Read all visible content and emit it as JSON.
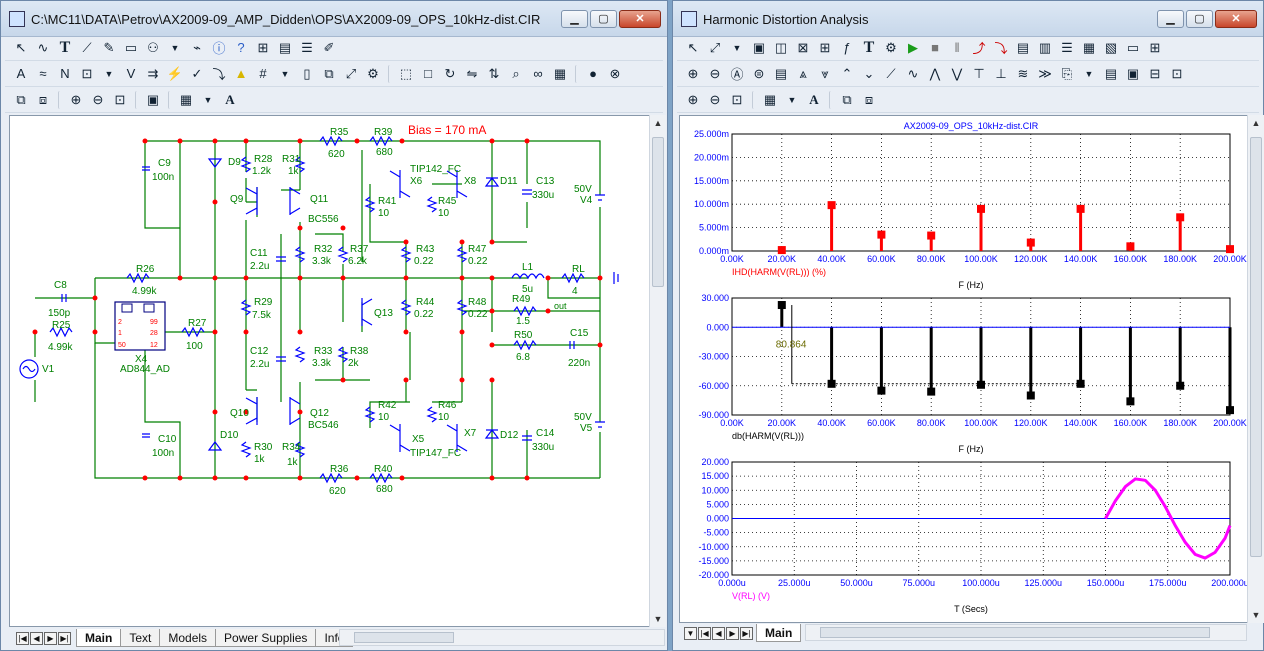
{
  "left_window": {
    "title": "C:\\MC11\\DATA\\Petrov\\AX2009-09_AMP_Didden\\OPS\\AX2009-09_OPS_10kHz-dist.CIR",
    "tabs": [
      "Main",
      "Text",
      "Models",
      "Power Supplies",
      "Info"
    ],
    "active_tab": "Main"
  },
  "schematic": {
    "bias_label": "Bias = 170 mA",
    "components": {
      "R35": "R35",
      "R35v": "620",
      "R39": "R39",
      "R39v": "680",
      "R36": "R36",
      "R36v": "620",
      "R40": "R40",
      "R40v": "680",
      "C9": "C9",
      "C9v": "100n",
      "C10": "C10",
      "C10v": "100n",
      "D9": "D9",
      "D10": "D10",
      "D11": "D11",
      "D12": "D12",
      "R28": "R28",
      "R28v": "1.2k",
      "R31": "R31",
      "R31v": "1k",
      "R30": "R30",
      "R30v": "1k",
      "R34": "R34",
      "R34v": "1k",
      "Q9": "Q9",
      "Q10": "Q10",
      "Q11": "Q11",
      "Q11m": "BC556",
      "Q12": "Q12",
      "Q12m": "BC546",
      "Q13": "Q13",
      "TIP142": "TIP142_FC",
      "TIP147": "TIP147_FC",
      "X6": "X6",
      "X8": "X8",
      "X5": "X5",
      "X7": "X7",
      "X4": "X4",
      "X4m": "AD844_AD",
      "R41": "R41",
      "R41v": "10",
      "R45": "R45",
      "R45v": "10",
      "R42": "R42",
      "R42v": "10",
      "R46": "R46",
      "R46v": "10",
      "C13": "C13",
      "C13v": "330u",
      "C14": "C14",
      "C14v": "330u",
      "V4": "V4",
      "V4v": "50V",
      "V5": "V5",
      "V5v": "50V",
      "C11": "C11",
      "C11v": "2.2u",
      "C12": "C12",
      "C12v": "2.2u",
      "R32": "R32",
      "R32v": "3.3k",
      "R33": "R33",
      "R33v": "3.3k",
      "R37": "R37",
      "R37v": "6.2k",
      "R38": "R38",
      "R38v": "2k",
      "R43": "R43",
      "R43v": "0.22",
      "R47": "R47",
      "R47v": "0.22",
      "R44": "R44",
      "R44v": "0.22",
      "R48": "R48",
      "R48v": "0.22",
      "L1": "L1",
      "L1v": "5u",
      "RL": "RL",
      "RLv": "4",
      "R49": "R49",
      "R49v": "1.5",
      "out": "out",
      "R50": "R50",
      "R50v": "6.8",
      "C15": "C15",
      "C15v": "220n",
      "C8": "C8",
      "C8v": "150p",
      "R25": "R25",
      "R25v": "4.99k",
      "R26": "R26",
      "R26v": "4.99k",
      "R27": "R27",
      "R27v": "100",
      "R29": "R29",
      "R29v": "7.5k",
      "V1": "V1",
      "p2": "2",
      "p1": "1",
      "p50": "50",
      "p99": "99",
      "p28": "28",
      "p12": "12"
    }
  },
  "right_window": {
    "title": "Harmonic Distortion Analysis",
    "tabs": [
      "Main"
    ],
    "active_tab": "Main"
  },
  "colors": {
    "wire": "#008000",
    "node": "#ff0000",
    "label": "#000080",
    "bias": "#ff0000",
    "ihd": "#ff0000",
    "db": "#000000",
    "vrl": "#ff00ff",
    "axis": "#0000ff"
  },
  "chart_data": [
    {
      "type": "bar",
      "title": "AX2009-09_OPS_10kHz-dist.CIR",
      "xlabel": "F (Hz)",
      "ylabel": "",
      "series": [
        {
          "name": "IHD(HARM(V(RL))) (%)",
          "x": [
            20000,
            40000,
            60000,
            80000,
            100000,
            120000,
            140000,
            160000,
            180000,
            200000
          ],
          "values": [
            0.2,
            9.8,
            3.5,
            3.3,
            9.0,
            1.8,
            9.0,
            1.0,
            7.2,
            0.4
          ]
        }
      ],
      "xlim": [
        0,
        200000
      ],
      "ylim": [
        0,
        25
      ],
      "x_ticks": [
        "0.00K",
        "20.00K",
        "40.00K",
        "60.00K",
        "80.00K",
        "100.00K",
        "120.00K",
        "140.00K",
        "160.00K",
        "180.00K",
        "200.00K"
      ],
      "y_ticks": [
        "0.000m",
        "5.000m",
        "10.000m",
        "15.000m",
        "20.000m",
        "25.000m"
      ],
      "grid": true
    },
    {
      "type": "bar",
      "xlabel": "F (Hz)",
      "series": [
        {
          "name": "db(HARM(V(RL)))",
          "x": [
            20000,
            40000,
            60000,
            80000,
            100000,
            120000,
            140000,
            160000,
            180000,
            200000
          ],
          "values": [
            22.8,
            -58,
            -65,
            -66,
            -59,
            -70,
            -58,
            -76,
            -60,
            -85
          ]
        }
      ],
      "xlim": [
        0,
        200000
      ],
      "ylim": [
        -90,
        30
      ],
      "x_ticks": [
        "0.00K",
        "20.00K",
        "40.00K",
        "60.00K",
        "80.00K",
        "100.00K",
        "120.00K",
        "140.00K",
        "160.00K",
        "180.00K",
        "200.00K"
      ],
      "y_ticks": [
        "30.000",
        "0.000",
        "-30.000",
        "-60.000",
        "-90.000"
      ],
      "annotation": "80.864",
      "grid": true
    },
    {
      "type": "line",
      "xlabel": "T (Secs)",
      "series": [
        {
          "name": "V(RL) (V)",
          "x": [
            0,
            150,
            154,
            158,
            162,
            166,
            170,
            174,
            178,
            182,
            186,
            190,
            194,
            198,
            200
          ],
          "values": [
            0,
            0,
            6.3,
            11.3,
            14,
            13.5,
            10,
            4.2,
            -2.5,
            -8.4,
            -12.7,
            -14,
            -12,
            -7,
            -2.5
          ]
        }
      ],
      "xlim": [
        0,
        200
      ],
      "ylim": [
        -20,
        20
      ],
      "x_ticks": [
        "0.000u",
        "25.000u",
        "50.000u",
        "75.000u",
        "100.000u",
        "125.000u",
        "150.000u",
        "175.000u",
        "200.000u"
      ],
      "y_ticks": [
        "20.000",
        "15.000",
        "10.000",
        "5.000",
        "0.000",
        "-5.000",
        "-10.000",
        "-15.000",
        "-20.000"
      ],
      "grid": true
    }
  ]
}
